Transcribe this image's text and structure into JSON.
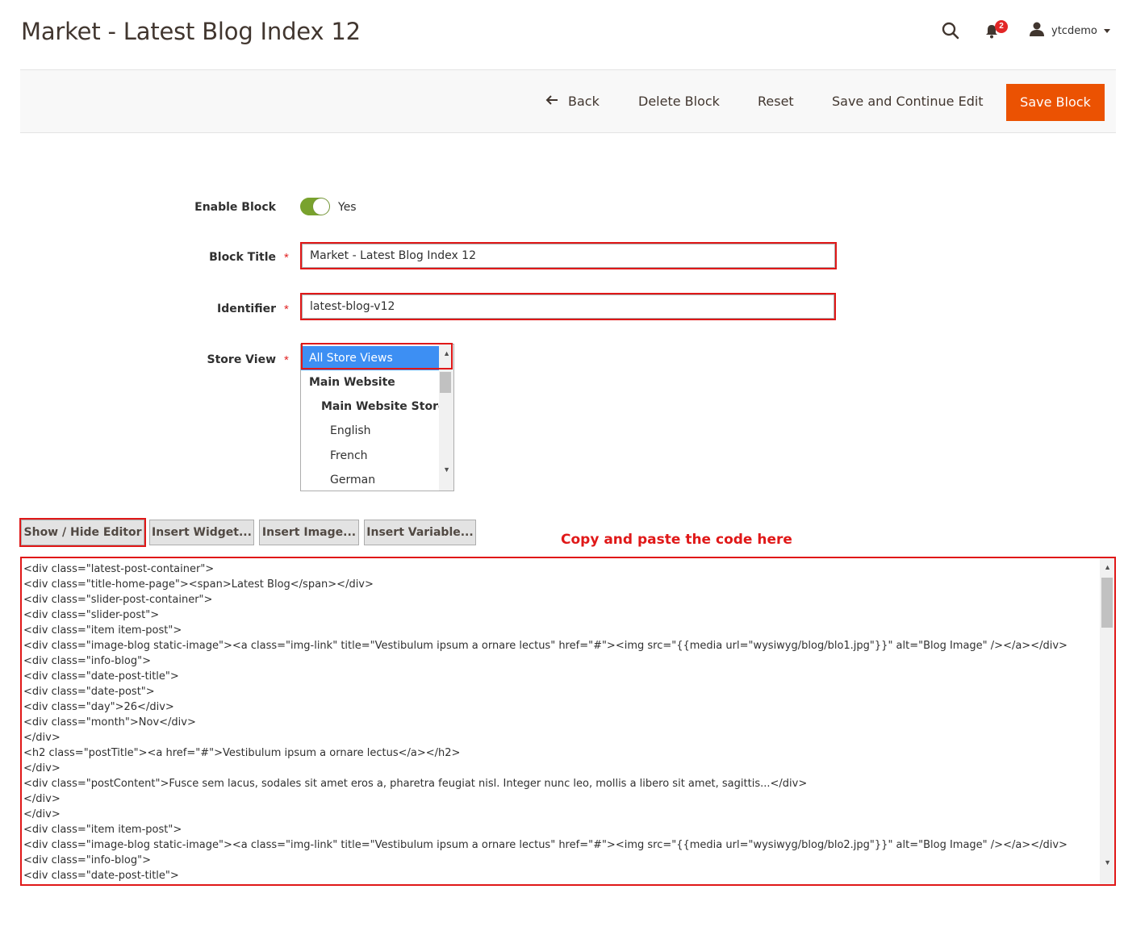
{
  "header": {
    "page_title": "Market - Latest Blog Index 12",
    "notifications_count": "2",
    "username": "ytcdemo"
  },
  "toolbar": {
    "back_label": "Back",
    "delete_label": "Delete Block",
    "reset_label": "Reset",
    "save_continue_label": "Save and Continue Edit",
    "save_label": "Save Block"
  },
  "form": {
    "enable_label": "Enable Block",
    "enable_value": "Yes",
    "title_label": "Block Title",
    "title_value": "Market - Latest Blog Index 12",
    "identifier_label": "Identifier",
    "identifier_value": "latest-blog-v12",
    "store_view_label": "Store View",
    "required_mark": "*",
    "store_views": [
      "All Store Views",
      "Main Website",
      "Main Website Store",
      "English",
      "French",
      "German"
    ]
  },
  "editor": {
    "show_hide_label": "Show / Hide Editor",
    "insert_widget_label": "Insert Widget...",
    "insert_image_label": "Insert Image...",
    "insert_variable_label": "Insert Variable...",
    "hint": "Copy and paste the code here",
    "code_lines": [
      "<div class=\"latest-post-container\">",
      "<div class=\"title-home-page\"><span>Latest Blog</span></div>",
      "<div class=\"slider-post-container\">",
      "<div class=\"slider-post\">",
      "<div class=\"item item-post\">",
      "<div class=\"image-blog static-image\"><a class=\"img-link\" title=\"Vestibulum ipsum a ornare lectus\" href=\"#\"><img src=\"{{media url=\"wysiwyg/blog/blo1.jpg\"}}\" alt=\"Blog Image\" /></a></div>",
      "<div class=\"info-blog\">",
      "<div class=\"date-post-title\">",
      "<div class=\"date-post\">",
      "<div class=\"day\">26</div>",
      "<div class=\"month\">Nov</div>",
      "</div>",
      "<h2 class=\"postTitle\"><a href=\"#\">Vestibulum ipsum a ornare lectus</a></h2>",
      "</div>",
      "<div class=\"postContent\">Fusce sem lacus, sodales sit amet eros a, pharetra feugiat nisl. Integer nunc leo, mollis a libero sit amet, sagittis...</div>",
      "</div>",
      "</div>",
      "<div class=\"item item-post\">",
      "<div class=\"image-blog static-image\"><a class=\"img-link\" title=\"Vestibulum ipsum a ornare lectus\" href=\"#\"><img src=\"{{media url=\"wysiwyg/blog/blo2.jpg\"}}\" alt=\"Blog Image\" /></a></div>",
      "<div class=\"info-blog\">",
      "<div class=\"date-post-title\">"
    ]
  },
  "colors": {
    "primary_button": "#eb5202",
    "toggle_on": "#79a22e",
    "selected_option": "#3d8ff3",
    "highlight": "#e01818"
  }
}
